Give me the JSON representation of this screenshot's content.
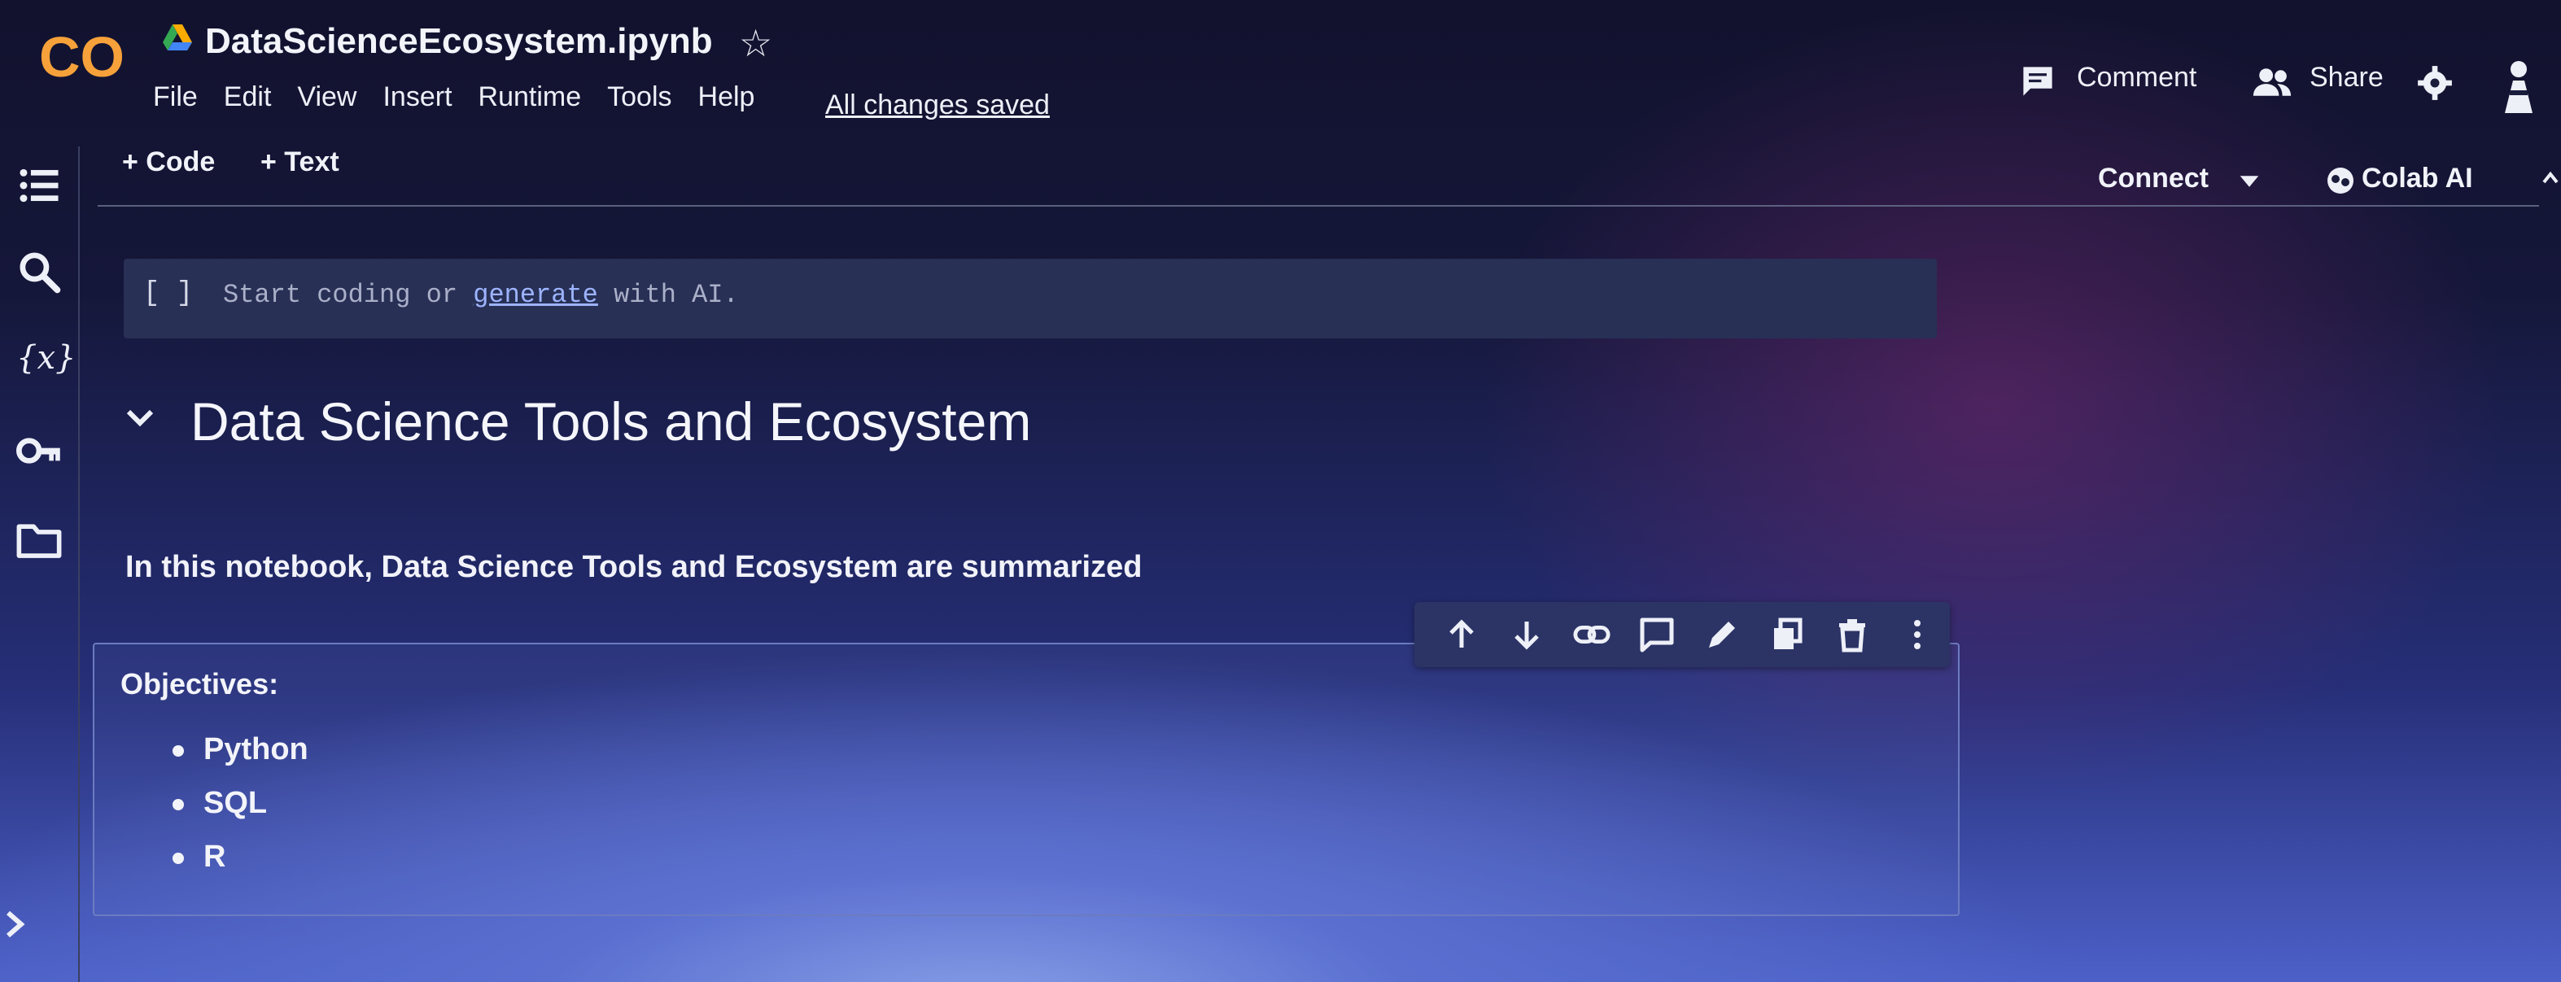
{
  "app": {
    "logo_text": "CO",
    "notebook_title": "DataScienceEcosystem.ipynb",
    "save_status": "All changes saved"
  },
  "menu": [
    "File",
    "Edit",
    "View",
    "Insert",
    "Runtime",
    "Tools",
    "Help"
  ],
  "header_actions": {
    "comment_label": "Comment",
    "share_label": "Share"
  },
  "toolbar": {
    "add_code_label": "+ Code",
    "add_text_label": "+ Text",
    "connect_label": "Connect",
    "colab_ai_label": "Colab AI"
  },
  "code_cell": {
    "bracket": "[ ]",
    "placeholder_before": "Start coding or ",
    "placeholder_link": "generate",
    "placeholder_after": " with AI."
  },
  "notebook": {
    "heading": "Data Science Tools and Ecosystem",
    "intro": "In this notebook, Data Science Tools and Ecosystem are summarized",
    "objectives_label": "Objectives:",
    "objectives": [
      "Python",
      "SQL",
      "R"
    ]
  },
  "icons": {
    "sidebar": [
      "table-of-contents-icon",
      "search-icon",
      "variables-icon",
      "secrets-key-icon",
      "files-folder-icon"
    ],
    "cell_toolbar": [
      "move-up-icon",
      "move-down-icon",
      "link-icon",
      "comment-icon",
      "edit-icon",
      "mirror-cell-icon",
      "delete-icon",
      "more-options-icon"
    ]
  },
  "colors": {
    "accent_orange": "#f9ab00",
    "logo_orange": "#f6a13a",
    "link_blue": "#9db4ff"
  }
}
